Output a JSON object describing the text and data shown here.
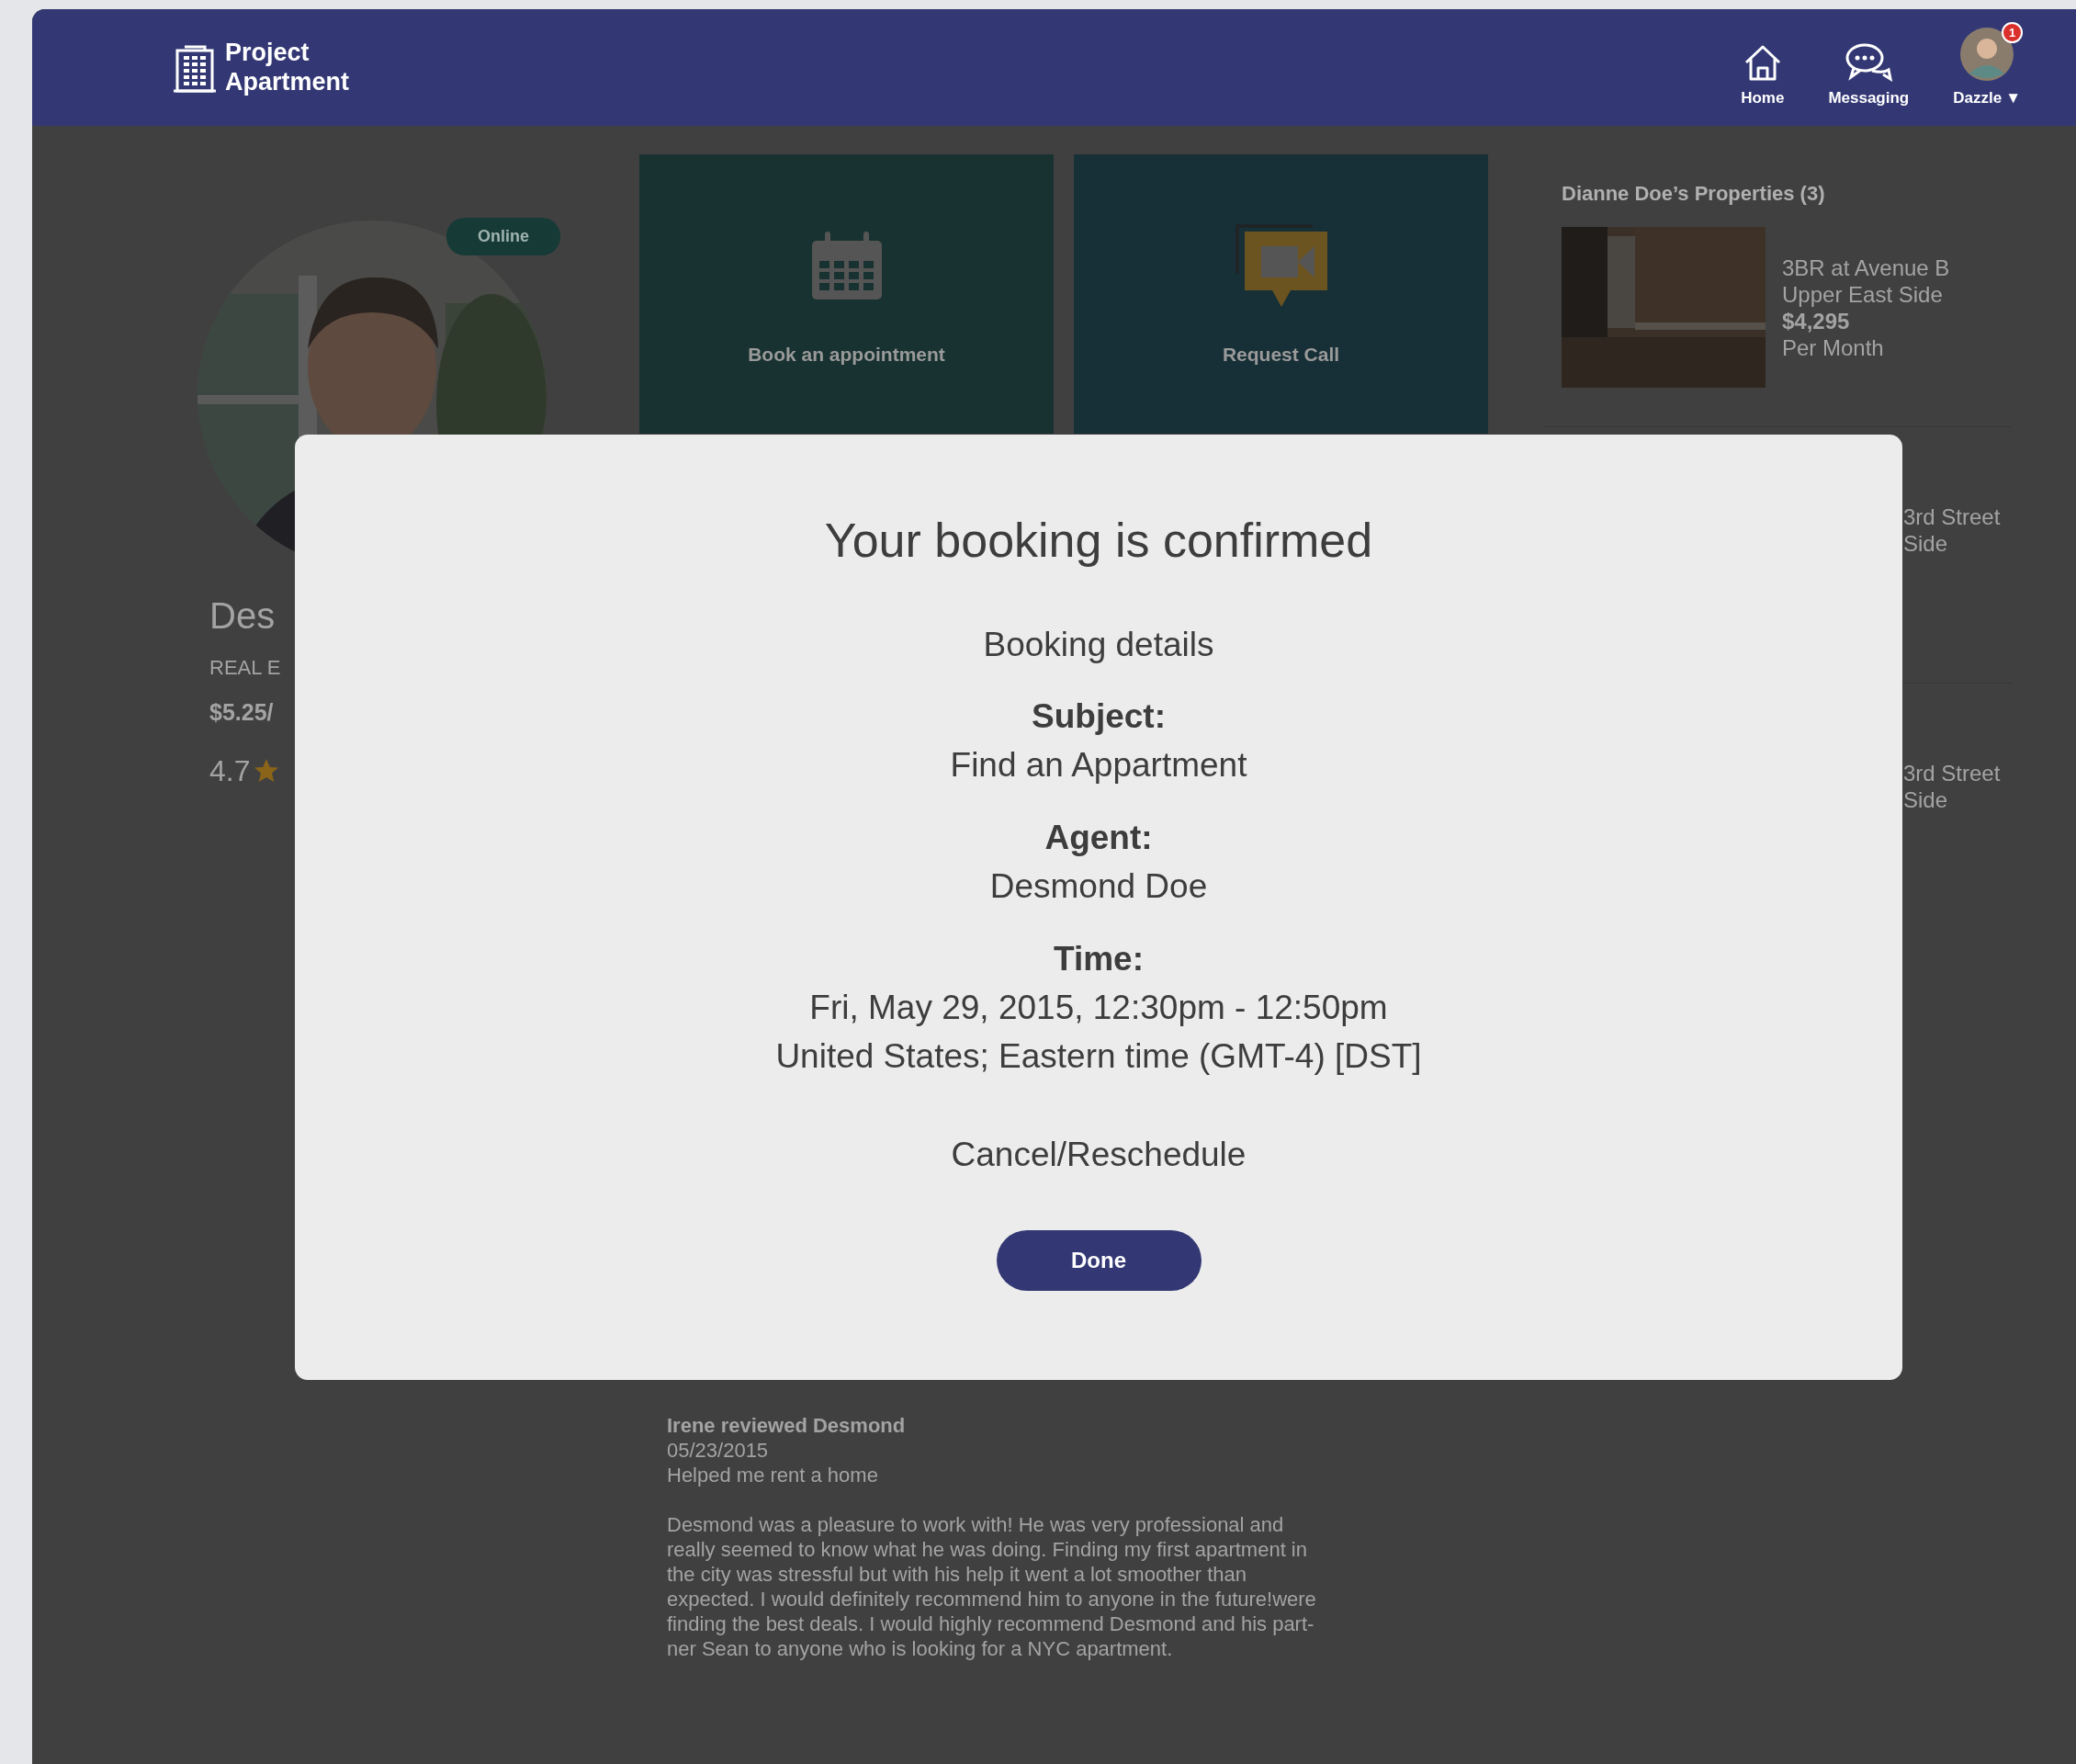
{
  "header": {
    "logo": "Project Apartment",
    "nav": [
      {
        "label": "Home"
      },
      {
        "label": "Messaging"
      }
    ],
    "user": {
      "label": "Dazzle",
      "caret": "▼",
      "badge": "1"
    }
  },
  "agent": {
    "status": "Online",
    "name": "Des",
    "title": "REAL E",
    "rate": "$5.25/",
    "rating": "4.7"
  },
  "actions": [
    {
      "label": "Book an appointment"
    },
    {
      "label": "Request Call"
    }
  ],
  "properties": {
    "title": "Dianne Doe’s Properties (3)",
    "items": [
      {
        "kind": "listing",
        "lines": [
          "3BR at Avenue B",
          "Upper East Side",
          "$4,295",
          "Per Month"
        ]
      },
      {
        "kind": "covered",
        "lines": [
          "3rd Street",
          "Side"
        ]
      },
      {
        "kind": "covered",
        "lines": [
          "3rd Street",
          "Side"
        ]
      }
    ]
  },
  "review": {
    "author": "Irene reviewed Desmond",
    "date": "05/23/2015",
    "headline": "Helped me rent a home",
    "body": [
      "Desmond was a pleasure to work with! He was very professional and",
      "really seemed to know what he was doing. Finding my first apartment in",
      "the city was stressful but with his help it went a lot smoother than",
      "expected. I would definitely recommend him to anyone in the future!were",
      "finding the best deals. I would highly recommend Desmond and his part-",
      "ner Sean to anyone who is looking for a NYC apartment."
    ]
  },
  "modal": {
    "title": "Your booking is confirmed",
    "subtitle": "Booking details",
    "fields": [
      {
        "label": "Subject:",
        "lines": [
          "Find an Appartment"
        ]
      },
      {
        "label": "Agent:",
        "lines": [
          "Desmond Doe"
        ]
      },
      {
        "label": "Time:",
        "lines": [
          "Fri, May 29, 2015, 12:30pm - 12:50pm",
          "United States; Eastern time (GMT-4) [DST]"
        ]
      }
    ],
    "link": "Cancel/Reschedule",
    "button": "Done"
  }
}
